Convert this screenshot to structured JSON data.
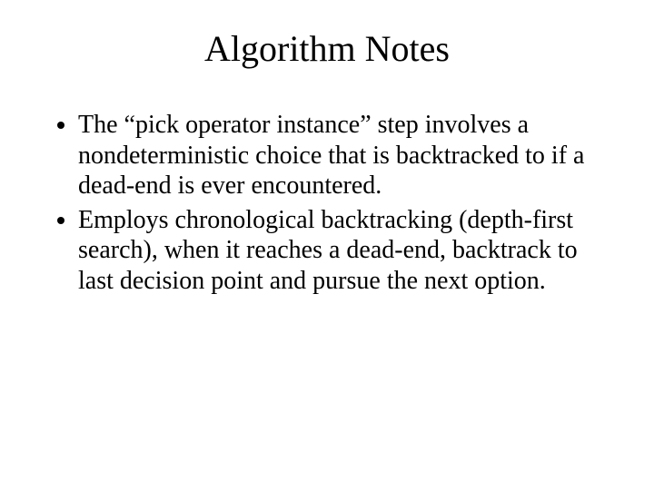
{
  "slide": {
    "title": "Algorithm Notes",
    "bullets": [
      "The “pick operator instance” step involves a nondeterministic choice that is backtracked to if a dead-end is ever encountered.",
      "Employs chronological backtracking (depth-first search), when it reaches a dead-end, backtrack to last decision point and pursue the next option."
    ]
  }
}
